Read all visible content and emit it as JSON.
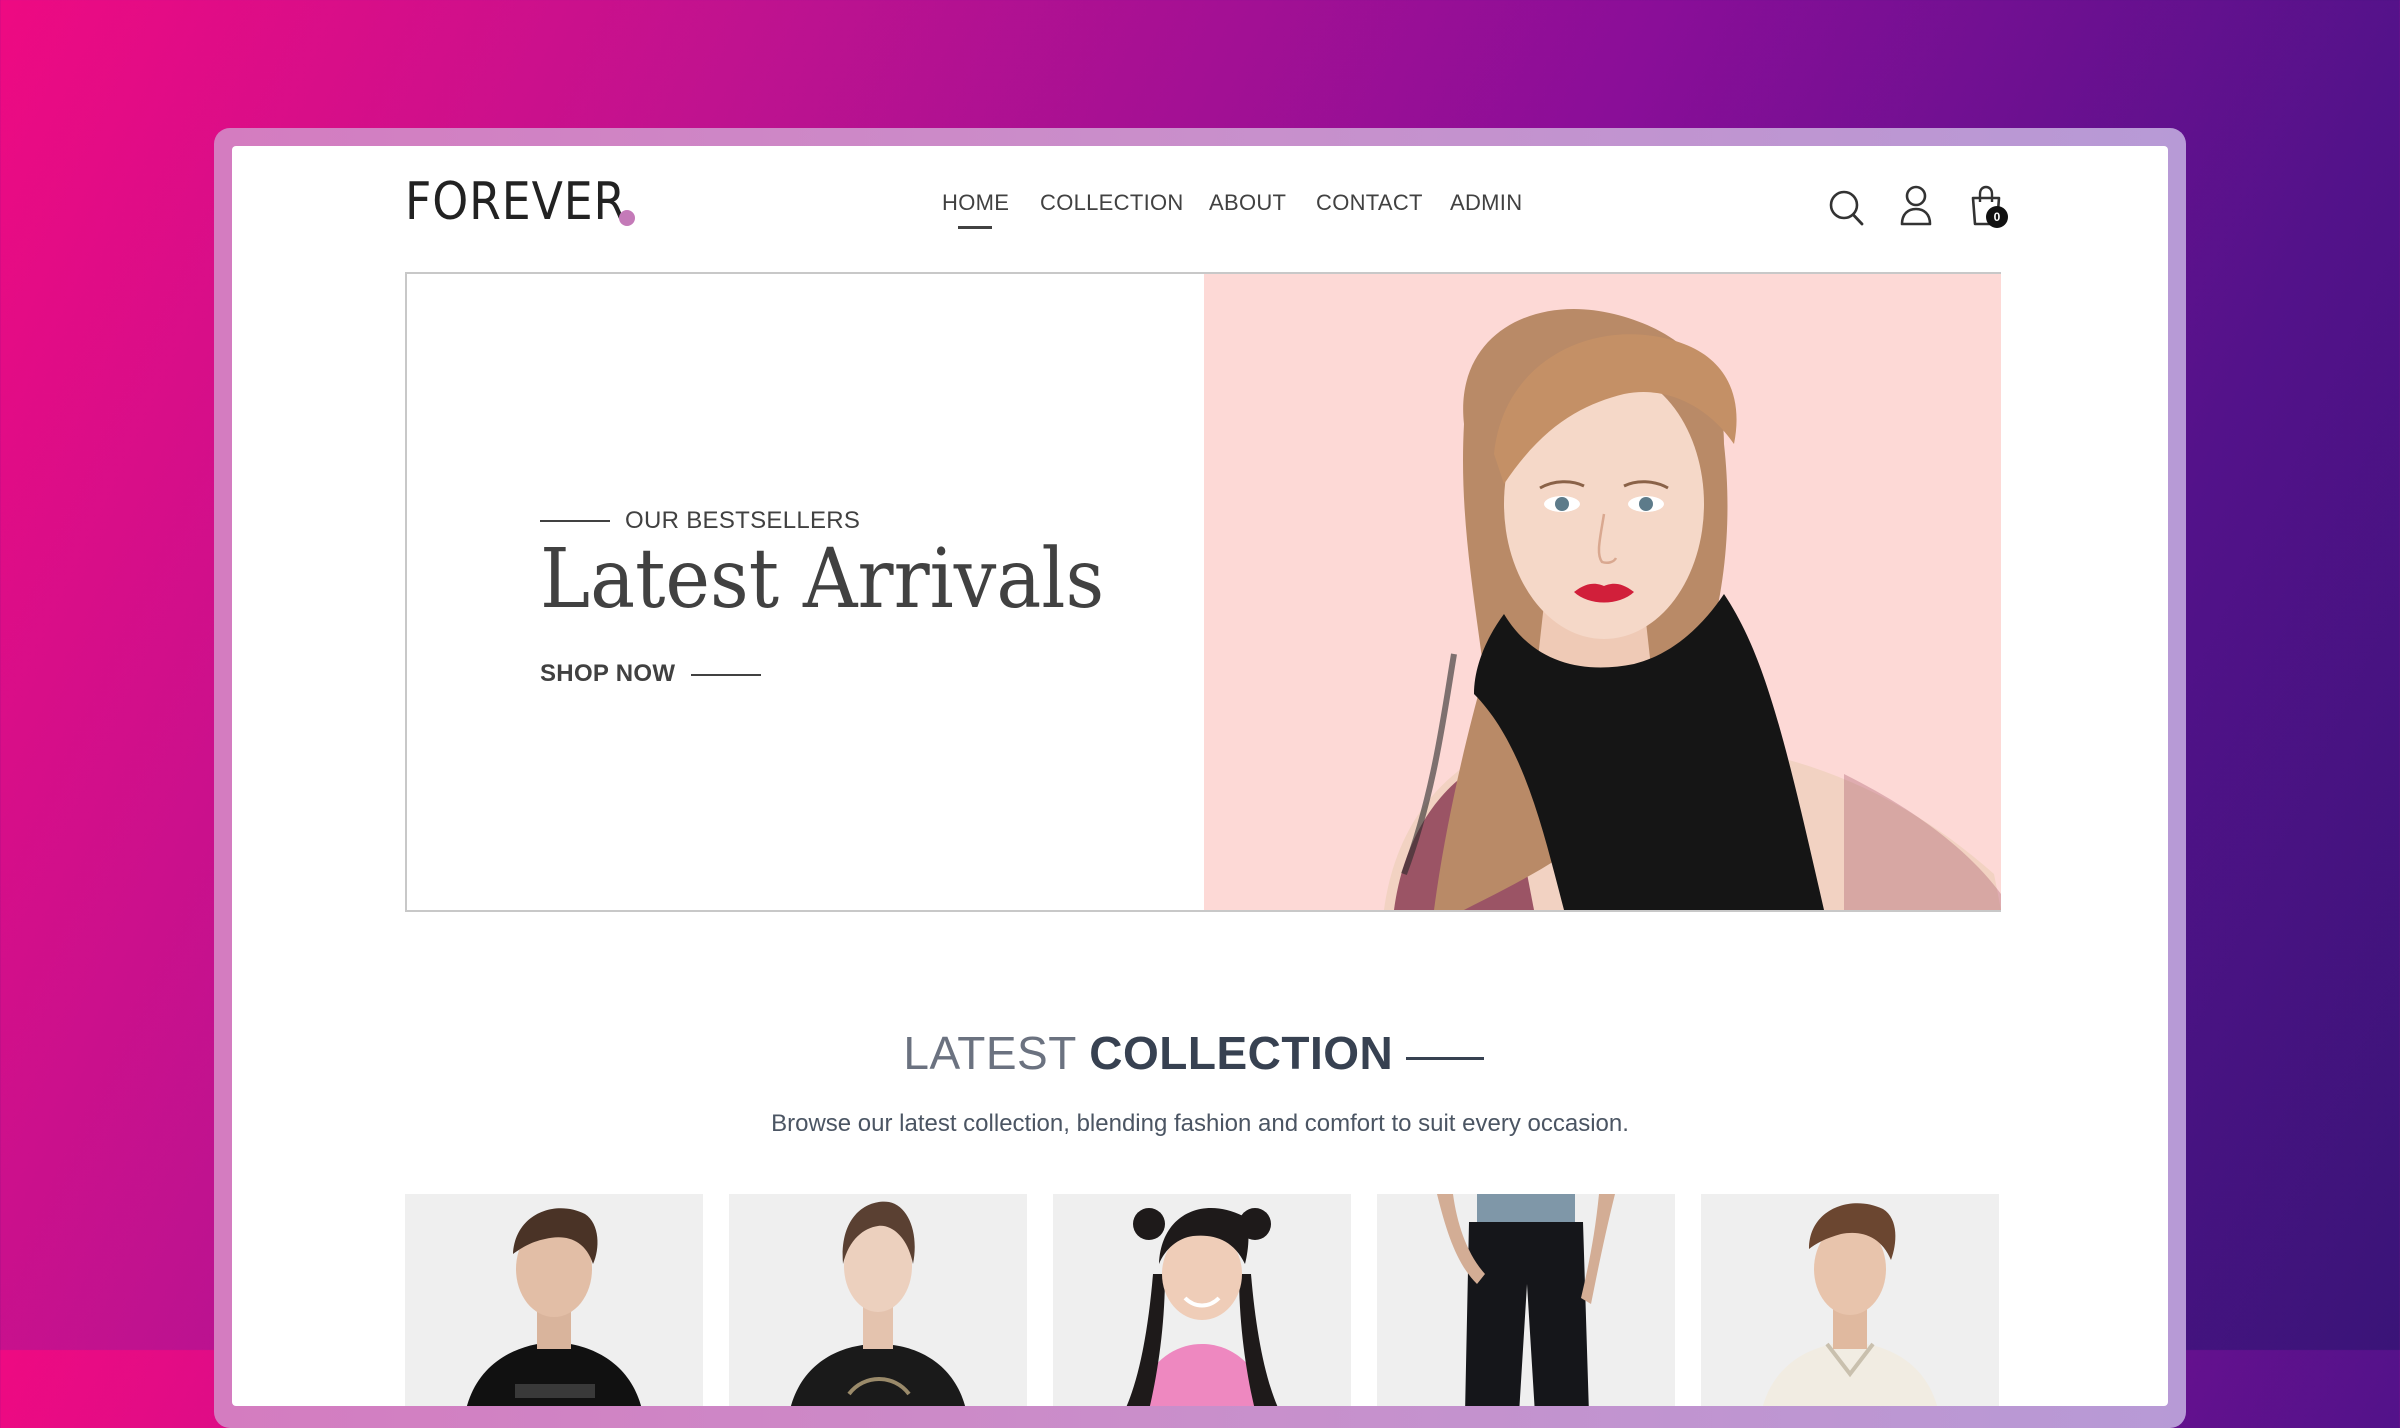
{
  "brand": {
    "logo_text": "FOREVER",
    "accent_color": "#c47ab8"
  },
  "nav": {
    "items": [
      {
        "label": "HOME",
        "active": true
      },
      {
        "label": "COLLECTION",
        "active": false
      },
      {
        "label": "ABOUT",
        "active": false
      },
      {
        "label": "CONTACT",
        "active": false
      },
      {
        "label": "ADMIN",
        "active": false
      }
    ]
  },
  "header_icons": {
    "search": "search-icon",
    "profile": "user-icon",
    "cart": "shopping-bag-icon",
    "cart_count": "0"
  },
  "hero": {
    "eyebrow": "OUR BESTSELLERS",
    "title": "Latest Arrivals",
    "cta": "SHOP NOW",
    "image_background": "#fdd9d6"
  },
  "latest_collection": {
    "title_light": "LATEST",
    "title_bold": "COLLECTION",
    "subtitle": "Browse our latest collection, blending fashion and comfort to suit every occasion.",
    "products": [
      {
        "image": "man-black-tshirt"
      },
      {
        "image": "woman-black-sweatshirt"
      },
      {
        "image": "girl-pink-top"
      },
      {
        "image": "man-black-jeans"
      },
      {
        "image": "man-cream-shirt"
      }
    ]
  }
}
